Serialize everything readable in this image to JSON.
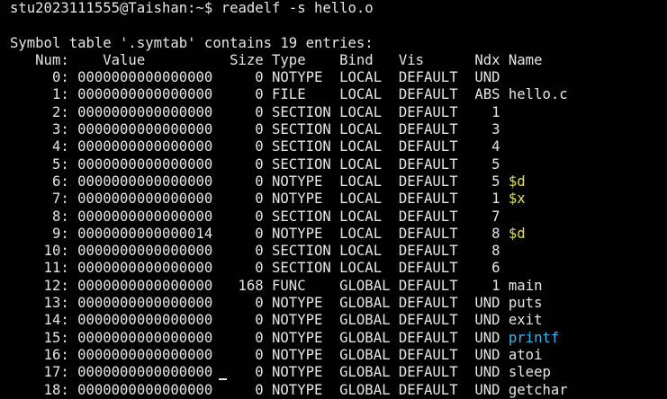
{
  "prompt": {
    "text": "stu2023111555@Taishan:~$ readelf -s hello.o"
  },
  "summary": "Symbol table '.symtab' contains 19 entries:",
  "header": "   Num:    Value          Size Type    Bind   Vis      Ndx Name",
  "rows": [
    {
      "prefix": "     0: 0000000000000000     0 NOTYPE  LOCAL  DEFAULT  UND ",
      "name": "",
      "color": "white"
    },
    {
      "prefix": "     1: 0000000000000000     0 FILE    LOCAL  DEFAULT  ABS ",
      "name": "hello.c",
      "color": "white"
    },
    {
      "prefix": "     2: 0000000000000000     0 SECTION LOCAL  DEFAULT    1 ",
      "name": "",
      "color": "white"
    },
    {
      "prefix": "     3: 0000000000000000     0 SECTION LOCAL  DEFAULT    3 ",
      "name": "",
      "color": "white"
    },
    {
      "prefix": "     4: 0000000000000000     0 SECTION LOCAL  DEFAULT    4 ",
      "name": "",
      "color": "white"
    },
    {
      "prefix": "     5: 0000000000000000     0 SECTION LOCAL  DEFAULT    5 ",
      "name": "",
      "color": "white"
    },
    {
      "prefix": "     6: 0000000000000000     0 NOTYPE  LOCAL  DEFAULT    5 ",
      "name": "$d",
      "color": "yellow"
    },
    {
      "prefix": "     7: 0000000000000000     0 NOTYPE  LOCAL  DEFAULT    1 ",
      "name": "$x",
      "color": "yellow"
    },
    {
      "prefix": "     8: 0000000000000000     0 SECTION LOCAL  DEFAULT    7 ",
      "name": "",
      "color": "white"
    },
    {
      "prefix": "     9: 0000000000000014     0 NOTYPE  LOCAL  DEFAULT    8 ",
      "name": "$d",
      "color": "yellow"
    },
    {
      "prefix": "    10: 0000000000000000     0 SECTION LOCAL  DEFAULT    8 ",
      "name": "",
      "color": "white"
    },
    {
      "prefix": "    11: 0000000000000000     0 SECTION LOCAL  DEFAULT    6 ",
      "name": "",
      "color": "white"
    },
    {
      "prefix": "    12: 0000000000000000   168 FUNC    GLOBAL DEFAULT    1 ",
      "name": "main",
      "color": "white"
    },
    {
      "prefix": "    13: 0000000000000000     0 NOTYPE  GLOBAL DEFAULT  UND ",
      "name": "puts",
      "color": "white"
    },
    {
      "prefix": "    14: 0000000000000000     0 NOTYPE  GLOBAL DEFAULT  UND ",
      "name": "exit",
      "color": "white"
    },
    {
      "prefix": "    15: 0000000000000000     0 NOTYPE  GLOBAL DEFAULT  UND ",
      "name": "printf",
      "color": "cyan"
    },
    {
      "prefix": "    16: 0000000000000000     0 NOTYPE  GLOBAL DEFAULT  UND ",
      "name": "atoi",
      "color": "white"
    },
    {
      "prefix": "    17: 0000000000000000     0 NOTYPE  GLOBAL DEFAULT  UND ",
      "name": "sleep",
      "color": "white"
    },
    {
      "prefix": "    18: 0000000000000000     0 NOTYPE  GLOBAL DEFAULT  UND ",
      "name": "getchar",
      "color": "white"
    }
  ],
  "colors": {
    "background": "#000000",
    "foreground": "#e6e6e6",
    "yellow": "#e2e24a",
    "cyan": "#3ab6f0"
  }
}
